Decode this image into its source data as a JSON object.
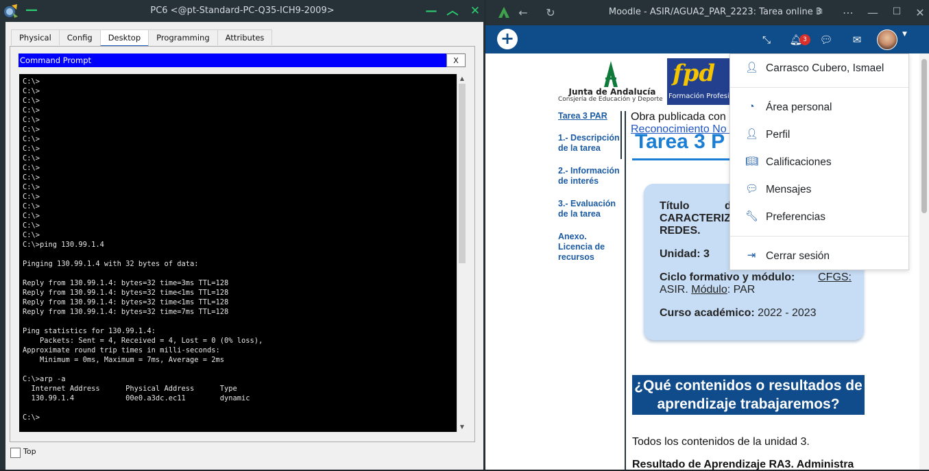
{
  "packet_tracer": {
    "title": "PC6 <@pt-Standard-PC-Q35-ICH9-2009>",
    "tabs": [
      {
        "label": "Physical",
        "active": false
      },
      {
        "label": "Config",
        "active": false
      },
      {
        "label": "Desktop",
        "active": true
      },
      {
        "label": "Programming",
        "active": false
      },
      {
        "label": "Attributes",
        "active": false
      }
    ],
    "command_prompt": {
      "title": "Command Prompt",
      "close_label": "X",
      "terminal_text": "C:\\>\nC:\\>\nC:\\>\nC:\\>\nC:\\>\nC:\\>\nC:\\>\nC:\\>\nC:\\>\nC:\\>\nC:\\>\nC:\\>\nC:\\>\nC:\\>\nC:\\>\nC:\\>\nC:\\>\nC:\\>ping 130.99.1.4\n\nPinging 130.99.1.4 with 32 bytes of data:\n\nReply from 130.99.1.4: bytes=32 time=3ms TTL=128\nReply from 130.99.1.4: bytes=32 time<1ms TTL=128\nReply from 130.99.1.4: bytes=32 time<1ms TTL=128\nReply from 130.99.1.4: bytes=32 time=7ms TTL=128\n\nPing statistics for 130.99.1.4:\n    Packets: Sent = 4, Received = 4, Lost = 0 (0% loss),\nApproximate round trip times in milli-seconds:\n    Minimum = 0ms, Maximum = 7ms, Average = 2ms\n\nC:\\>arp -a\n  Internet Address      Physical Address      Type\n  130.99.1.4            00e0.a3dc.ec11        dynamic\n\nC:\\>"
    },
    "top_checkbox_label": "Top"
  },
  "browser": {
    "title": "Moodle - ASIR/AGUA2_PAR_2223: Tarea online 3",
    "notification_count": "3",
    "logos": {
      "junta_name": "Junta de Andalucía",
      "junta_sub": "Consjería de Educación y Deporte",
      "fp_text": "Formación Profesional"
    },
    "toc": [
      "Tarea 3 PAR",
      "1.- Descripción de la tarea",
      "2.- Información de interés",
      "3.- Evaluación de la tarea",
      "Anexo. Licencia de recursos"
    ],
    "obra_text": "Obra publicada con L",
    "obra_link": "Reconocimiento No C",
    "task_title": "Tarea 3 P",
    "card": {
      "titulo_label": "Título",
      "titulo_tail": "d",
      "titulo_value": "CARACTERIZ",
      "titulo_value2": "REDES.",
      "unidad": "Unidad: 3",
      "ciclo_label": "Ciclo formativo y módulo:",
      "ciclo_link": "CFGS:",
      "ciclo_asir": "ASIR.",
      "modulo_link": "Módulo",
      "modulo_value": ": PAR",
      "curso_label": "Curso académico:",
      "curso_value": "2022 - 2023"
    },
    "section_banner": "¿Qué contenidos o resultados de aprendizaje trabajaremos?",
    "todos_text": "Todos los contenidos de la unidad 3.",
    "resultado_text": "Resultado de Aprendizaje RA3. Administra",
    "user_menu": {
      "user_name": "Carrasco Cubero, Ismael",
      "items": [
        {
          "label": "Área personal",
          "icon": "dashboard-icon"
        },
        {
          "label": "Perfil",
          "icon": "user-icon"
        },
        {
          "label": "Calificaciones",
          "icon": "grades-icon"
        },
        {
          "label": "Mensajes",
          "icon": "message-icon"
        },
        {
          "label": "Preferencias",
          "icon": "wrench-icon"
        }
      ],
      "logout": "Cerrar sesión"
    }
  }
}
